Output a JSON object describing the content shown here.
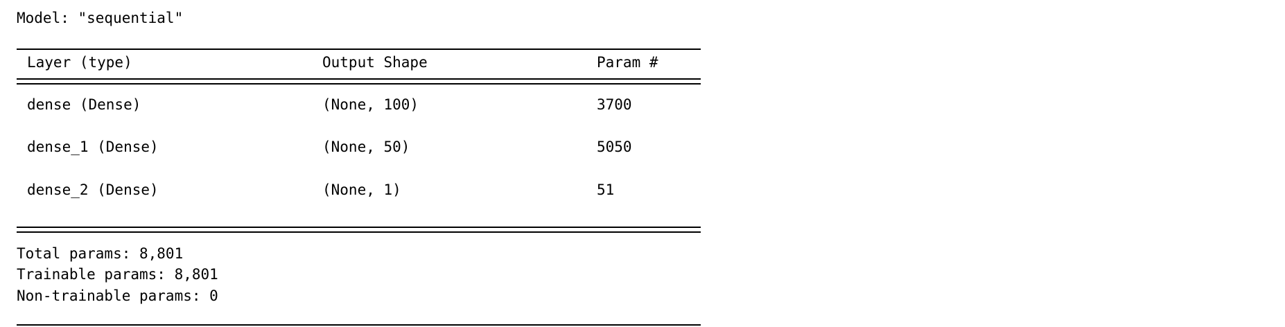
{
  "summary": {
    "model_line": "Model: \"sequential\"",
    "headers": {
      "layer": "Layer (type)",
      "output_shape": "Output Shape",
      "params": "Param #"
    },
    "rows": [
      {
        "layer": "dense (Dense)",
        "output_shape": "(None, 100)",
        "params": "3700"
      },
      {
        "layer": "dense_1 (Dense)",
        "output_shape": "(None, 50)",
        "params": "5050"
      },
      {
        "layer": "dense_2 (Dense)",
        "output_shape": "(None, 1)",
        "params": "51"
      }
    ],
    "total_params": "Total params: 8,801",
    "trainable_params": "Trainable params: 8,801",
    "non_trainable_params": "Non-trainable params: 0"
  }
}
